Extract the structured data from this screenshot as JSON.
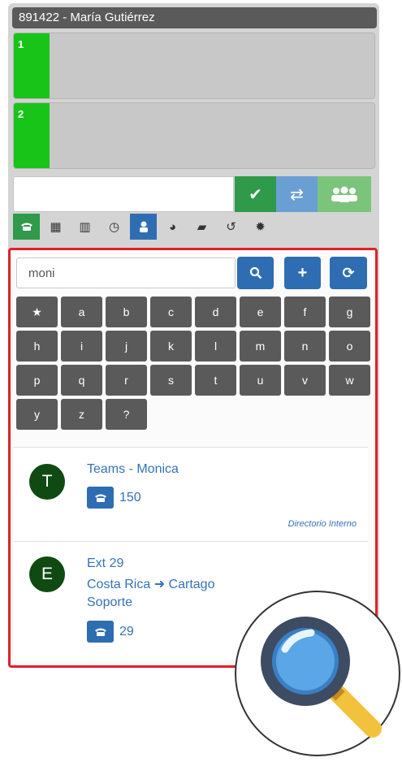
{
  "title": "891422 - María Gutiérrez",
  "lines": [
    {
      "label": "1"
    },
    {
      "label": "2"
    }
  ],
  "dial": {
    "value": ""
  },
  "actions": {
    "accept_icon": "check-icon",
    "transfer_icon": "transfer-icon",
    "conference_icon": "group-icon"
  },
  "tabs": [
    "phone-icon",
    "dialpad-icon",
    "contacts-book-icon",
    "clock-icon",
    "user-icon",
    "globe-icon",
    "chat-icon",
    "exit-icon",
    "gear-icon"
  ],
  "search": {
    "value": "moni",
    "placeholder": ""
  },
  "keys": [
    "★",
    "a",
    "b",
    "c",
    "d",
    "e",
    "f",
    "g",
    "h",
    "i",
    "j",
    "k",
    "l",
    "m",
    "n",
    "o",
    "p",
    "q",
    "r",
    "s",
    "t",
    "u",
    "v",
    "w",
    "y",
    "z",
    "?"
  ],
  "results": [
    {
      "initial": "T",
      "name": "Teams - Monica",
      "lines": [],
      "ext": "150",
      "source": "Directorio Interno"
    },
    {
      "initial": "E",
      "name": "Ext 29",
      "lines": [
        "Costa Rica ➜ Cartago",
        "Soporte"
      ],
      "ext": "29",
      "source": ""
    }
  ],
  "colors": {
    "accent_green": "#2e9a4a",
    "accent_blue": "#2f6db3",
    "line_green": "#19c419",
    "highlight_red": "#e0202a"
  }
}
